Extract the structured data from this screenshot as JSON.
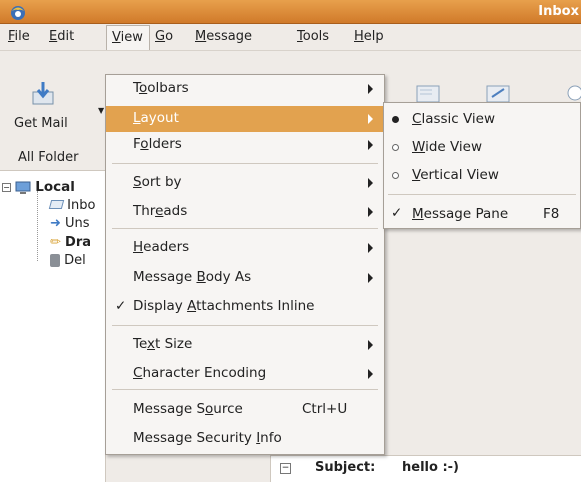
{
  "window": {
    "title": "Inbox"
  },
  "menubar": {
    "items": [
      "File",
      "Edit",
      "View",
      "Go",
      "Message",
      "Tools",
      "Help"
    ]
  },
  "toolbar": {
    "get_mail": "Get Mail",
    "all_folders": "All Folder"
  },
  "folders": {
    "local": "Local",
    "inbox": "Inbo",
    "unsent": "Uns",
    "drafts": "Dra",
    "deleted": "Del"
  },
  "view_menu": {
    "toolbars": "Toolbars",
    "layout": "Layout",
    "folders": "Folders",
    "sort_by": "Sort by",
    "threads": "Threads",
    "headers": "Headers",
    "message_body_as": "Message Body As",
    "display_attachments_inline": "Display Attachments Inline",
    "text_size": "Text Size",
    "character_encoding": "Character Encoding",
    "message_source": "Message Source",
    "message_source_shortcut": "Ctrl+U",
    "message_security_info": "Message Security Info"
  },
  "layout_submenu": {
    "classic_view": "Classic View",
    "wide_view": "Wide View",
    "vertical_view": "Vertical View",
    "message_pane": "Message Pane",
    "message_pane_shortcut": "F8",
    "selected": "Classic View",
    "message_pane_checked": true
  },
  "message": {
    "subject_label": "Subject:",
    "subject_value": "hello :-)"
  },
  "colors": {
    "title_bar": "#d88a38",
    "highlight": "#e2a24f",
    "background": "#efebe7"
  },
  "check_glyph": "✓"
}
